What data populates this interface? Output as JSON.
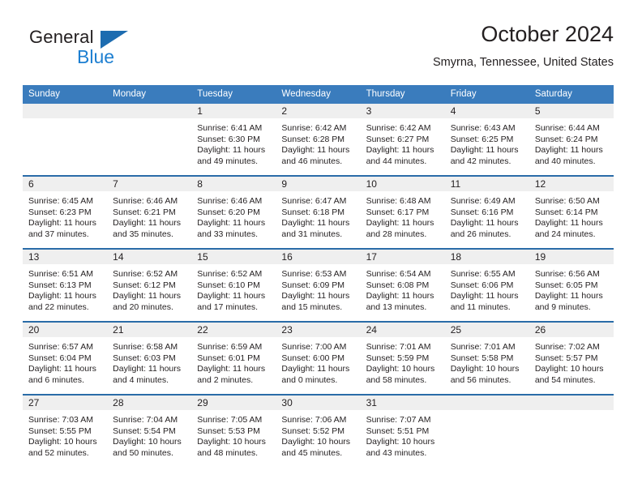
{
  "brand": {
    "name_top": "General",
    "name_bottom": "Blue",
    "accent_color": "#1d7fd1",
    "triangle_color": "#1d6cb0"
  },
  "header": {
    "title": "October 2024",
    "location": "Smyrna, Tennessee, United States"
  },
  "theme": {
    "header_row_bg": "#3a7cbd",
    "week_divider": "#2a6ca8",
    "daynum_band_bg": "#efefef",
    "text_color": "#231f20"
  },
  "calendar": {
    "weekday_headers": [
      "Sunday",
      "Monday",
      "Tuesday",
      "Wednesday",
      "Thursday",
      "Friday",
      "Saturday"
    ],
    "weeks": [
      [
        {
          "day": "",
          "empty": true
        },
        {
          "day": "",
          "empty": true
        },
        {
          "day": "1",
          "sunrise": "Sunrise: 6:41 AM",
          "sunset": "Sunset: 6:30 PM",
          "daylight_1": "Daylight: 11 hours",
          "daylight_2": "and 49 minutes."
        },
        {
          "day": "2",
          "sunrise": "Sunrise: 6:42 AM",
          "sunset": "Sunset: 6:28 PM",
          "daylight_1": "Daylight: 11 hours",
          "daylight_2": "and 46 minutes."
        },
        {
          "day": "3",
          "sunrise": "Sunrise: 6:42 AM",
          "sunset": "Sunset: 6:27 PM",
          "daylight_1": "Daylight: 11 hours",
          "daylight_2": "and 44 minutes."
        },
        {
          "day": "4",
          "sunrise": "Sunrise: 6:43 AM",
          "sunset": "Sunset: 6:25 PM",
          "daylight_1": "Daylight: 11 hours",
          "daylight_2": "and 42 minutes."
        },
        {
          "day": "5",
          "sunrise": "Sunrise: 6:44 AM",
          "sunset": "Sunset: 6:24 PM",
          "daylight_1": "Daylight: 11 hours",
          "daylight_2": "and 40 minutes."
        }
      ],
      [
        {
          "day": "6",
          "sunrise": "Sunrise: 6:45 AM",
          "sunset": "Sunset: 6:23 PM",
          "daylight_1": "Daylight: 11 hours",
          "daylight_2": "and 37 minutes."
        },
        {
          "day": "7",
          "sunrise": "Sunrise: 6:46 AM",
          "sunset": "Sunset: 6:21 PM",
          "daylight_1": "Daylight: 11 hours",
          "daylight_2": "and 35 minutes."
        },
        {
          "day": "8",
          "sunrise": "Sunrise: 6:46 AM",
          "sunset": "Sunset: 6:20 PM",
          "daylight_1": "Daylight: 11 hours",
          "daylight_2": "and 33 minutes."
        },
        {
          "day": "9",
          "sunrise": "Sunrise: 6:47 AM",
          "sunset": "Sunset: 6:18 PM",
          "daylight_1": "Daylight: 11 hours",
          "daylight_2": "and 31 minutes."
        },
        {
          "day": "10",
          "sunrise": "Sunrise: 6:48 AM",
          "sunset": "Sunset: 6:17 PM",
          "daylight_1": "Daylight: 11 hours",
          "daylight_2": "and 28 minutes."
        },
        {
          "day": "11",
          "sunrise": "Sunrise: 6:49 AM",
          "sunset": "Sunset: 6:16 PM",
          "daylight_1": "Daylight: 11 hours",
          "daylight_2": "and 26 minutes."
        },
        {
          "day": "12",
          "sunrise": "Sunrise: 6:50 AM",
          "sunset": "Sunset: 6:14 PM",
          "daylight_1": "Daylight: 11 hours",
          "daylight_2": "and 24 minutes."
        }
      ],
      [
        {
          "day": "13",
          "sunrise": "Sunrise: 6:51 AM",
          "sunset": "Sunset: 6:13 PM",
          "daylight_1": "Daylight: 11 hours",
          "daylight_2": "and 22 minutes."
        },
        {
          "day": "14",
          "sunrise": "Sunrise: 6:52 AM",
          "sunset": "Sunset: 6:12 PM",
          "daylight_1": "Daylight: 11 hours",
          "daylight_2": "and 20 minutes."
        },
        {
          "day": "15",
          "sunrise": "Sunrise: 6:52 AM",
          "sunset": "Sunset: 6:10 PM",
          "daylight_1": "Daylight: 11 hours",
          "daylight_2": "and 17 minutes."
        },
        {
          "day": "16",
          "sunrise": "Sunrise: 6:53 AM",
          "sunset": "Sunset: 6:09 PM",
          "daylight_1": "Daylight: 11 hours",
          "daylight_2": "and 15 minutes."
        },
        {
          "day": "17",
          "sunrise": "Sunrise: 6:54 AM",
          "sunset": "Sunset: 6:08 PM",
          "daylight_1": "Daylight: 11 hours",
          "daylight_2": "and 13 minutes."
        },
        {
          "day": "18",
          "sunrise": "Sunrise: 6:55 AM",
          "sunset": "Sunset: 6:06 PM",
          "daylight_1": "Daylight: 11 hours",
          "daylight_2": "and 11 minutes."
        },
        {
          "day": "19",
          "sunrise": "Sunrise: 6:56 AM",
          "sunset": "Sunset: 6:05 PM",
          "daylight_1": "Daylight: 11 hours",
          "daylight_2": "and 9 minutes."
        }
      ],
      [
        {
          "day": "20",
          "sunrise": "Sunrise: 6:57 AM",
          "sunset": "Sunset: 6:04 PM",
          "daylight_1": "Daylight: 11 hours",
          "daylight_2": "and 6 minutes."
        },
        {
          "day": "21",
          "sunrise": "Sunrise: 6:58 AM",
          "sunset": "Sunset: 6:03 PM",
          "daylight_1": "Daylight: 11 hours",
          "daylight_2": "and 4 minutes."
        },
        {
          "day": "22",
          "sunrise": "Sunrise: 6:59 AM",
          "sunset": "Sunset: 6:01 PM",
          "daylight_1": "Daylight: 11 hours",
          "daylight_2": "and 2 minutes."
        },
        {
          "day": "23",
          "sunrise": "Sunrise: 7:00 AM",
          "sunset": "Sunset: 6:00 PM",
          "daylight_1": "Daylight: 11 hours",
          "daylight_2": "and 0 minutes."
        },
        {
          "day": "24",
          "sunrise": "Sunrise: 7:01 AM",
          "sunset": "Sunset: 5:59 PM",
          "daylight_1": "Daylight: 10 hours",
          "daylight_2": "and 58 minutes."
        },
        {
          "day": "25",
          "sunrise": "Sunrise: 7:01 AM",
          "sunset": "Sunset: 5:58 PM",
          "daylight_1": "Daylight: 10 hours",
          "daylight_2": "and 56 minutes."
        },
        {
          "day": "26",
          "sunrise": "Sunrise: 7:02 AM",
          "sunset": "Sunset: 5:57 PM",
          "daylight_1": "Daylight: 10 hours",
          "daylight_2": "and 54 minutes."
        }
      ],
      [
        {
          "day": "27",
          "sunrise": "Sunrise: 7:03 AM",
          "sunset": "Sunset: 5:55 PM",
          "daylight_1": "Daylight: 10 hours",
          "daylight_2": "and 52 minutes."
        },
        {
          "day": "28",
          "sunrise": "Sunrise: 7:04 AM",
          "sunset": "Sunset: 5:54 PM",
          "daylight_1": "Daylight: 10 hours",
          "daylight_2": "and 50 minutes."
        },
        {
          "day": "29",
          "sunrise": "Sunrise: 7:05 AM",
          "sunset": "Sunset: 5:53 PM",
          "daylight_1": "Daylight: 10 hours",
          "daylight_2": "and 48 minutes."
        },
        {
          "day": "30",
          "sunrise": "Sunrise: 7:06 AM",
          "sunset": "Sunset: 5:52 PM",
          "daylight_1": "Daylight: 10 hours",
          "daylight_2": "and 45 minutes."
        },
        {
          "day": "31",
          "sunrise": "Sunrise: 7:07 AM",
          "sunset": "Sunset: 5:51 PM",
          "daylight_1": "Daylight: 10 hours",
          "daylight_2": "and 43 minutes."
        },
        {
          "day": "",
          "empty": true
        },
        {
          "day": "",
          "empty": true
        }
      ]
    ]
  }
}
